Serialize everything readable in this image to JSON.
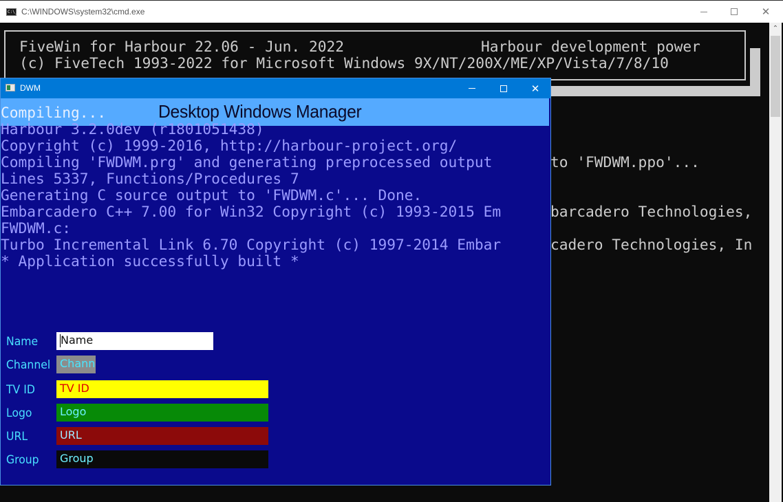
{
  "cmd_window": {
    "title": "C:\\WINDOWS\\system32\\cmd.exe",
    "icon_text": "C:\\_",
    "controls": {
      "minimize": "minimize",
      "maximize": "maximize",
      "close": "✕"
    },
    "scroll_up_glyph": "⌃"
  },
  "console": {
    "banner_line1_left": "FiveWin for Harbour 22.06 - Jun. 2022",
    "banner_line1_right": "Harbour development power",
    "banner_line2": "(c) FiveTech 1993-2022 for Microsoft Windows 9X/NT/200X/ME/XP/Vista/7/8/10",
    "overflow_lines": [
      {
        "text": "to 'FWDWM.ppo'..."
      },
      {
        "text": "barcadero Technologies,"
      },
      {
        "text": "cadero Technologies, In"
      }
    ]
  },
  "dwm_window": {
    "title": "DWM",
    "controls": {
      "minimize": "minimize",
      "maximize": "maximize",
      "close": "✕"
    },
    "header_title": "Desktop Windows Manager",
    "output_lines": [
      "Compiling...",
      "Harbour 3.2.0dev (r1801051438)",
      "Copyright (c) 1999-2016, http://harbour-project.org/",
      "Compiling 'FWDWM.prg' and generating preprocessed output",
      "Lines 5337, Functions/Procedures 7",
      "Generating C source output to 'FWDWM.c'... Done.",
      "Embarcadero C++ 7.00 for Win32 Copyright (c) 1993-2015 Em",
      "FWDWM.c:",
      "Turbo Incremental Link 6.70 Copyright (c) 1997-2014 Embar",
      "* Application successfully built *"
    ],
    "form": {
      "fields": [
        {
          "label": "Name",
          "value": "Name",
          "bg": "#ffffff",
          "fg": "#111111"
        },
        {
          "label": "Channel",
          "value": "Channel",
          "bg": "#8c8c8c",
          "fg": "#4ae6ff"
        },
        {
          "label": "TV ID",
          "value": "TV ID",
          "bg": "#ffff00",
          "fg": "#e00000"
        },
        {
          "label": "Logo",
          "value": "Logo",
          "bg": "#078a07",
          "fg": "#6ef0ff"
        },
        {
          "label": "URL",
          "value": "URL",
          "bg": "#8c0a0a",
          "fg": "#a0e8ff"
        },
        {
          "label": "Group",
          "value": "Group",
          "bg": "#0a0a0a",
          "fg": "#6ef0ff"
        }
      ]
    }
  },
  "colors": {
    "console_bg": "#0c0c0c",
    "console_text": "#cccccc",
    "dwm_bg": "#0a0a8c",
    "dwm_titlebar": "#0078d7",
    "dwm_header": "#55aaff",
    "dwm_text": "#9b9bff",
    "label_text": "#49e0ff"
  }
}
